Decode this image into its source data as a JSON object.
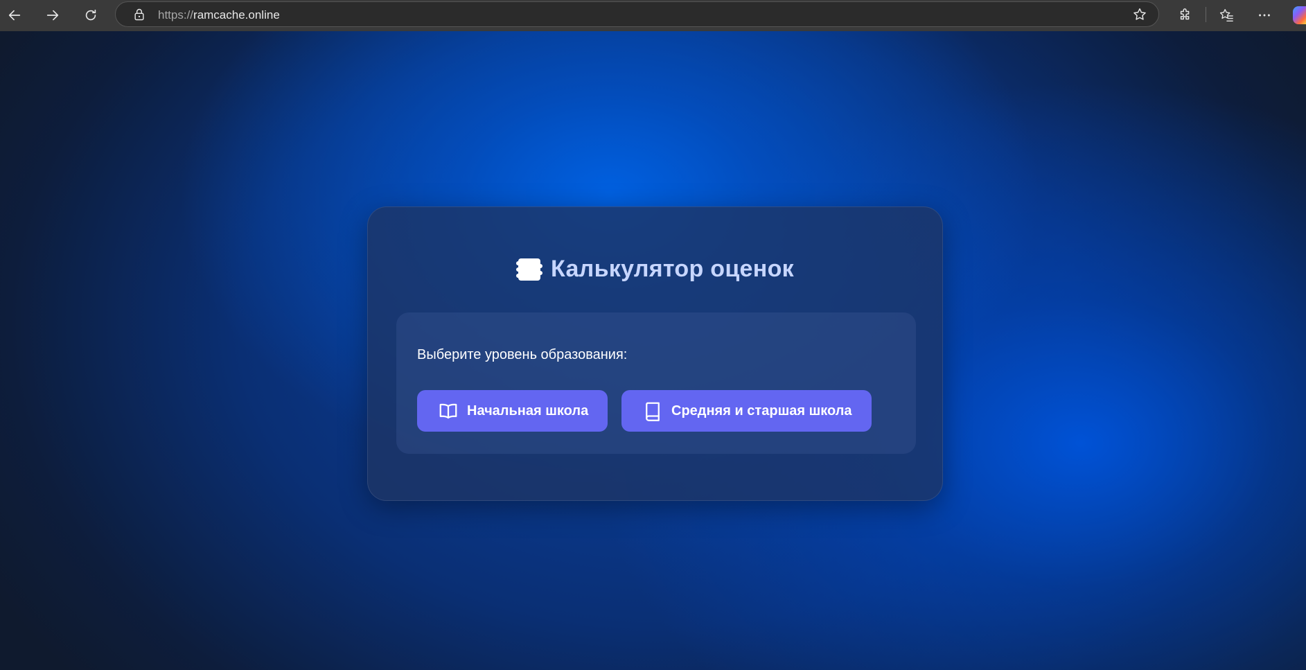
{
  "browser": {
    "url_scheme": "https://",
    "url_host": "ramcache.online",
    "icons": [
      "back-icon",
      "forward-icon",
      "refresh-icon",
      "lock-icon",
      "star-icon",
      "extensions-icon",
      "favorites-icon",
      "more-icon",
      "copilot-icon"
    ]
  },
  "app": {
    "title": "Калькулятор оценок",
    "prompt": "Выберите уровень образования:",
    "buttons": [
      {
        "label": "Начальная школа",
        "icon": "open-book-icon"
      },
      {
        "label": "Средняя и старшая школа",
        "icon": "closed-book-icon"
      }
    ],
    "colors": {
      "accent": "#6366f1",
      "title": "#c7d6ff",
      "card": "#1e3464"
    }
  }
}
